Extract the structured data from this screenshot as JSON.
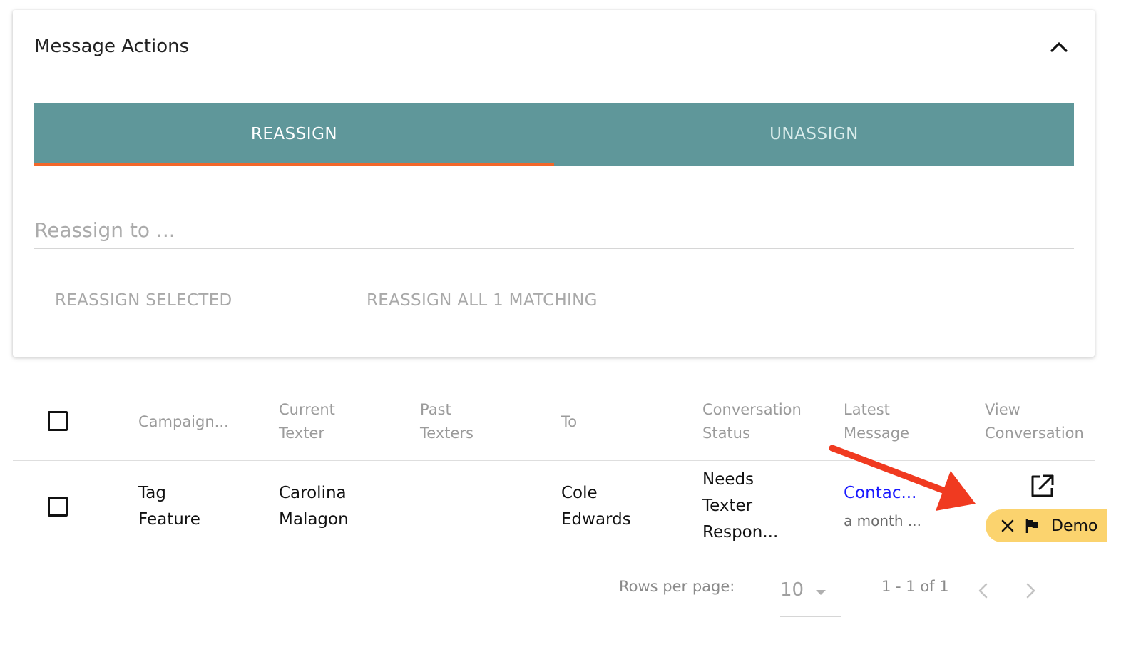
{
  "panel": {
    "title": "Message Actions",
    "collapse_icon": "chevron-up-icon"
  },
  "tabs": [
    {
      "label": "REASSIGN",
      "active": true
    },
    {
      "label": "UNASSIGN",
      "active": false
    }
  ],
  "reassign": {
    "placeholder": "Reassign to ...",
    "value": "",
    "reassign_selected_label": "REASSIGN SELECTED",
    "reassign_all_label": "REASSIGN ALL 1 MATCHING"
  },
  "table": {
    "columns": [
      "Campaign...",
      "Current Texter",
      "Past Texters",
      "To",
      "Conversation Status",
      "Latest Message",
      "View Conversation"
    ],
    "rows": [
      {
        "campaign": "Tag Feature",
        "current_texter": "Carolina Malagon",
        "past_texters": "",
        "to": "Cole Edwards",
        "status": "Needs Texter Respon...",
        "latest_message": "Contac...",
        "latest_message_time": "a month ...",
        "view_icon": "open-in-new-icon",
        "tag": {
          "label": "Demo",
          "icons": [
            "close-icon",
            "flag-icon"
          ]
        }
      }
    ]
  },
  "pagination": {
    "rows_per_page_label": "Rows per page:",
    "rows_per_page_value": "10",
    "range_text": "1 - 1 of 1"
  },
  "colors": {
    "tab_bar": "#5f979a",
    "tab_indicator": "#f2672a",
    "tag_chip": "#fbd36e",
    "link": "#1a1aff",
    "annotation_arrow": "#f03a20"
  }
}
